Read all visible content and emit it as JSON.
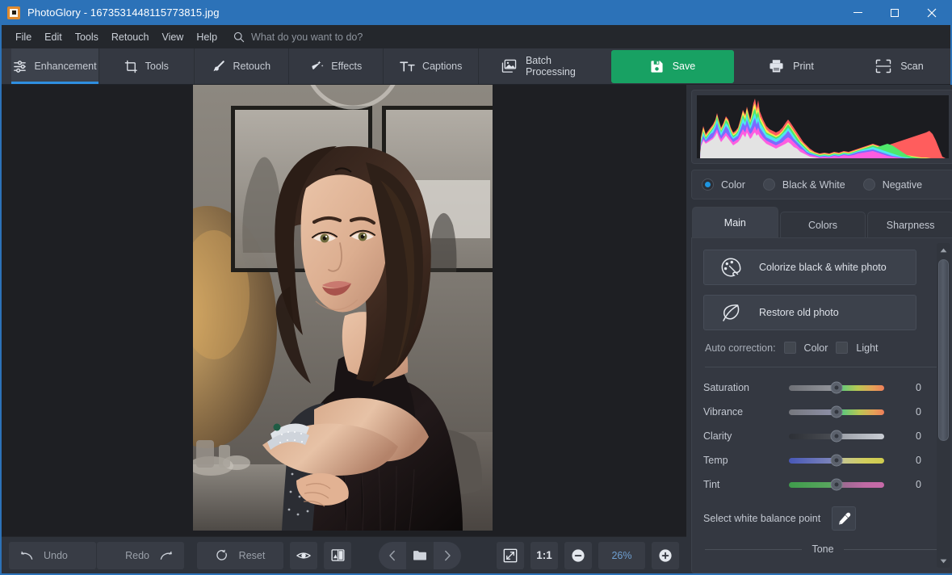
{
  "window": {
    "title": "PhotoGlory - 1673531448115773815.jpg",
    "icon": "film-frame-icon",
    "controls": {
      "minimize": "minimize-icon",
      "maximize": "maximize-icon",
      "close": "close-icon"
    },
    "accent_blue": "#2c72b8"
  },
  "menubar": {
    "items": [
      "File",
      "Edit",
      "Tools",
      "Retouch",
      "View",
      "Help"
    ],
    "search": {
      "icon": "search-icon",
      "placeholder": "What do you want to do?",
      "value": ""
    }
  },
  "toolbar": {
    "tabs": [
      {
        "label": "Enhancement",
        "icon": "sliders-icon",
        "active": true
      },
      {
        "label": "Tools",
        "icon": "crop-icon",
        "active": false
      },
      {
        "label": "Retouch",
        "icon": "brush-icon",
        "active": false
      },
      {
        "label": "Effects",
        "icon": "magic-wand-icon",
        "active": false
      },
      {
        "label": "Captions",
        "icon": "text-icon",
        "active": false
      }
    ],
    "actions": [
      {
        "label": "Batch Processing",
        "icon": "images-icon",
        "style": "normal"
      },
      {
        "label": "Save",
        "icon": "floppy-disk-icon",
        "style": "primary",
        "color": "#18a163"
      },
      {
        "label": "Print",
        "icon": "printer-icon",
        "style": "normal"
      },
      {
        "label": "Scan",
        "icon": "scan-frame-icon",
        "style": "normal"
      }
    ]
  },
  "canvas": {
    "photo_alt": "portrait-photo",
    "background": "#1e1f23"
  },
  "bottombar": {
    "undo": {
      "label": "Undo",
      "icon": "undo-arrow-icon"
    },
    "redo": {
      "label": "Redo",
      "icon": "redo-arrow-icon"
    },
    "reset": {
      "label": "Reset",
      "icon": "reset-circle-icon"
    },
    "preview": {
      "icon": "eye-icon"
    },
    "compare": {
      "icon": "before-after-icon"
    },
    "nav": {
      "prev": "chevron-left-icon",
      "open": "folder-icon",
      "next": "chevron-right-icon"
    },
    "fit": {
      "icon": "fit-screen-icon"
    },
    "one_to_one": "1:1",
    "zoom_out": {
      "icon": "minus-circle-icon"
    },
    "zoom_value": "26%",
    "zoom_in": {
      "icon": "plus-circle-icon"
    }
  },
  "rightpanel": {
    "histogram": {
      "label": "histogram",
      "background": "#1b1c20"
    },
    "modes": [
      {
        "label": "Color",
        "selected": true
      },
      {
        "label": "Black & White",
        "selected": false
      },
      {
        "label": "Negative",
        "selected": false
      }
    ],
    "tabs": [
      {
        "label": "Main",
        "active": true
      },
      {
        "label": "Colors",
        "active": false
      },
      {
        "label": "Sharpness",
        "active": false
      }
    ],
    "buttons": [
      {
        "label": "Colorize black & white photo",
        "icon": "palette-icon"
      },
      {
        "label": "Restore old photo",
        "icon": "leaf-icon"
      }
    ],
    "auto_correction": {
      "label": "Auto correction:",
      "options": [
        {
          "label": "Color",
          "checked": false
        },
        {
          "label": "Light",
          "checked": false
        }
      ]
    },
    "sliders": [
      {
        "label": "Saturation",
        "value": "0",
        "position": 50
      },
      {
        "label": "Vibrance",
        "value": "0",
        "position": 50
      },
      {
        "label": "Clarity",
        "value": "0",
        "position": 50
      },
      {
        "label": "Temp",
        "value": "0",
        "position": 50
      },
      {
        "label": "Tint",
        "value": "0",
        "position": 50
      }
    ],
    "white_balance": {
      "label": "Select white balance point",
      "icon": "eyedropper-icon"
    },
    "tone_divider": "Tone",
    "scrollbar": {
      "up": "scroll-up-arrow-icon",
      "down": "scroll-down-arrow-icon"
    }
  }
}
